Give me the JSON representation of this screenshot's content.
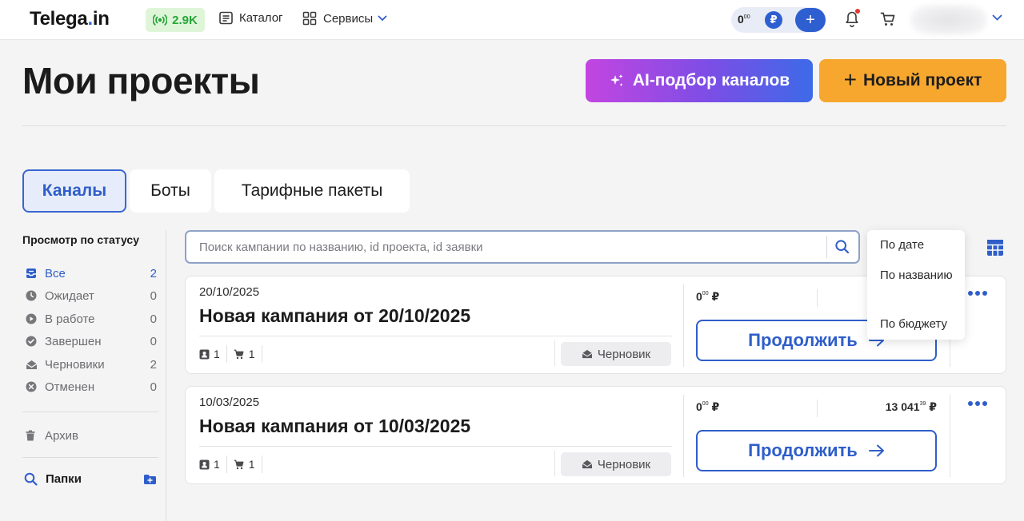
{
  "header": {
    "logo_text": "Telega",
    "logo_dot": ".",
    "logo_suffix": "in",
    "reach_value": "2.9K",
    "nav": {
      "catalog": "Каталог",
      "services": "Сервисы"
    },
    "balance": {
      "amount": "0",
      "amount_decimals": "00",
      "currency": "₽",
      "add": "+"
    }
  },
  "page": {
    "title": "Мои проекты",
    "ai_button": "AI-подбор каналов",
    "new_project_plus": "+",
    "new_project_button": "Новый проект"
  },
  "tabs": [
    {
      "label": "Каналы",
      "active": true
    },
    {
      "label": "Боты",
      "active": false
    },
    {
      "label": "Тарифные пакеты",
      "active": false
    }
  ],
  "sidebar": {
    "title": "Просмотр по статусу",
    "statuses": [
      {
        "label": "Все",
        "count": "2"
      },
      {
        "label": "Ожидает",
        "count": "0"
      },
      {
        "label": "В работе",
        "count": "0"
      },
      {
        "label": "Завершен",
        "count": "0"
      },
      {
        "label": "Черновики",
        "count": "2"
      },
      {
        "label": "Отменен",
        "count": "0"
      }
    ],
    "archive": "Архив",
    "folders": "Папки"
  },
  "search": {
    "placeholder": "Поиск кампании по названию, id проекта, id заявки"
  },
  "sort_menu": {
    "options": [
      "По дате",
      "По названию",
      "По бюджету"
    ]
  },
  "campaigns": [
    {
      "date": "20/10/2025",
      "name": "Новая кампания от 20/10/2025",
      "channels_count": "1",
      "cart_count": "1",
      "status": "Черновик",
      "spent": "0",
      "spent_decimals": "00",
      "budget": "",
      "budget_decimals": "",
      "currency": "₽",
      "action": "Продолжить"
    },
    {
      "date": "10/03/2025",
      "name": "Новая кампания от 10/03/2025",
      "channels_count": "1",
      "cart_count": "1",
      "status": "Черновик",
      "spent": "0",
      "spent_decimals": "00",
      "budget": "13 041",
      "budget_decimals": "39",
      "currency": "₽",
      "action": "Продолжить"
    }
  ],
  "colors": {
    "accent": "#2f5ec9",
    "orange": "#f7a72e",
    "reach_green": "#26a53a"
  }
}
